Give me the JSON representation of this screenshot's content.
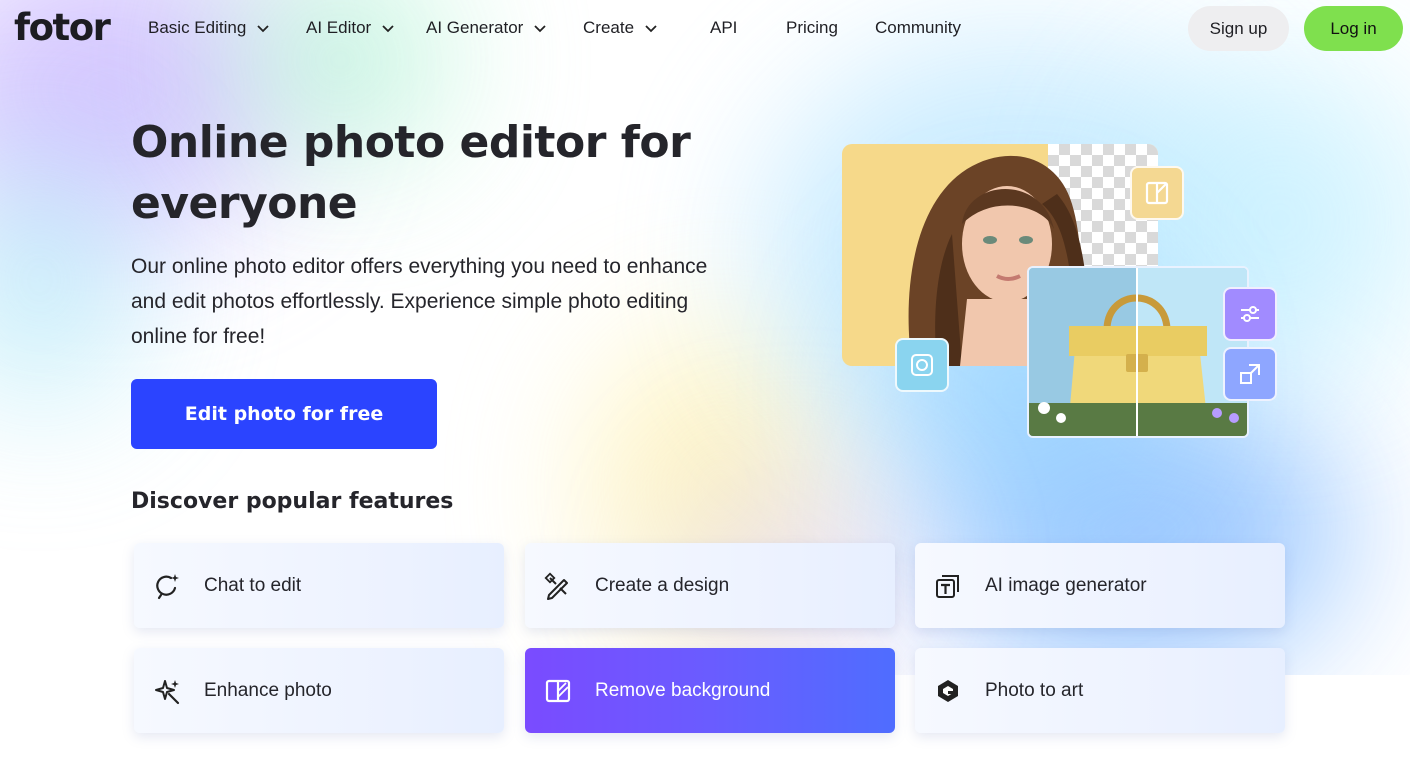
{
  "brand": {
    "logo": "fotor"
  },
  "nav": {
    "items": [
      {
        "label": "Basic Editing",
        "has_dropdown": true
      },
      {
        "label": "AI Editor",
        "has_dropdown": true
      },
      {
        "label": "AI Generator",
        "has_dropdown": true
      },
      {
        "label": "Create",
        "has_dropdown": true
      },
      {
        "label": "API",
        "has_dropdown": false
      },
      {
        "label": "Pricing",
        "has_dropdown": false
      },
      {
        "label": "Community",
        "has_dropdown": false
      }
    ],
    "signup_label": "Sign up",
    "login_label": "Log in"
  },
  "hero": {
    "title": "Online photo editor for everyone",
    "description": "Our online photo editor offers everything you need to enhance and edit photos effortlessly. Experience simple photo editing online for free!",
    "cta_label": "Edit photo for free"
  },
  "features": {
    "heading": "Discover popular features",
    "cards": [
      {
        "label": "Chat to edit",
        "icon": "chat-sparkle-icon",
        "active": false
      },
      {
        "label": "Create a design",
        "icon": "design-tools-icon",
        "active": false
      },
      {
        "label": "AI image generator",
        "icon": "image-text-icon",
        "active": false
      },
      {
        "label": "Enhance photo",
        "icon": "enhance-sparkle-icon",
        "active": false
      },
      {
        "label": "Remove background",
        "icon": "remove-background-icon",
        "active": true
      },
      {
        "label": "Photo to art",
        "icon": "art-logo-icon",
        "active": false
      }
    ]
  },
  "colors": {
    "cta": "#2b44ff",
    "login": "#7fe04e",
    "active_card_start": "#7a4bff",
    "active_card_end": "#4f6dff"
  }
}
